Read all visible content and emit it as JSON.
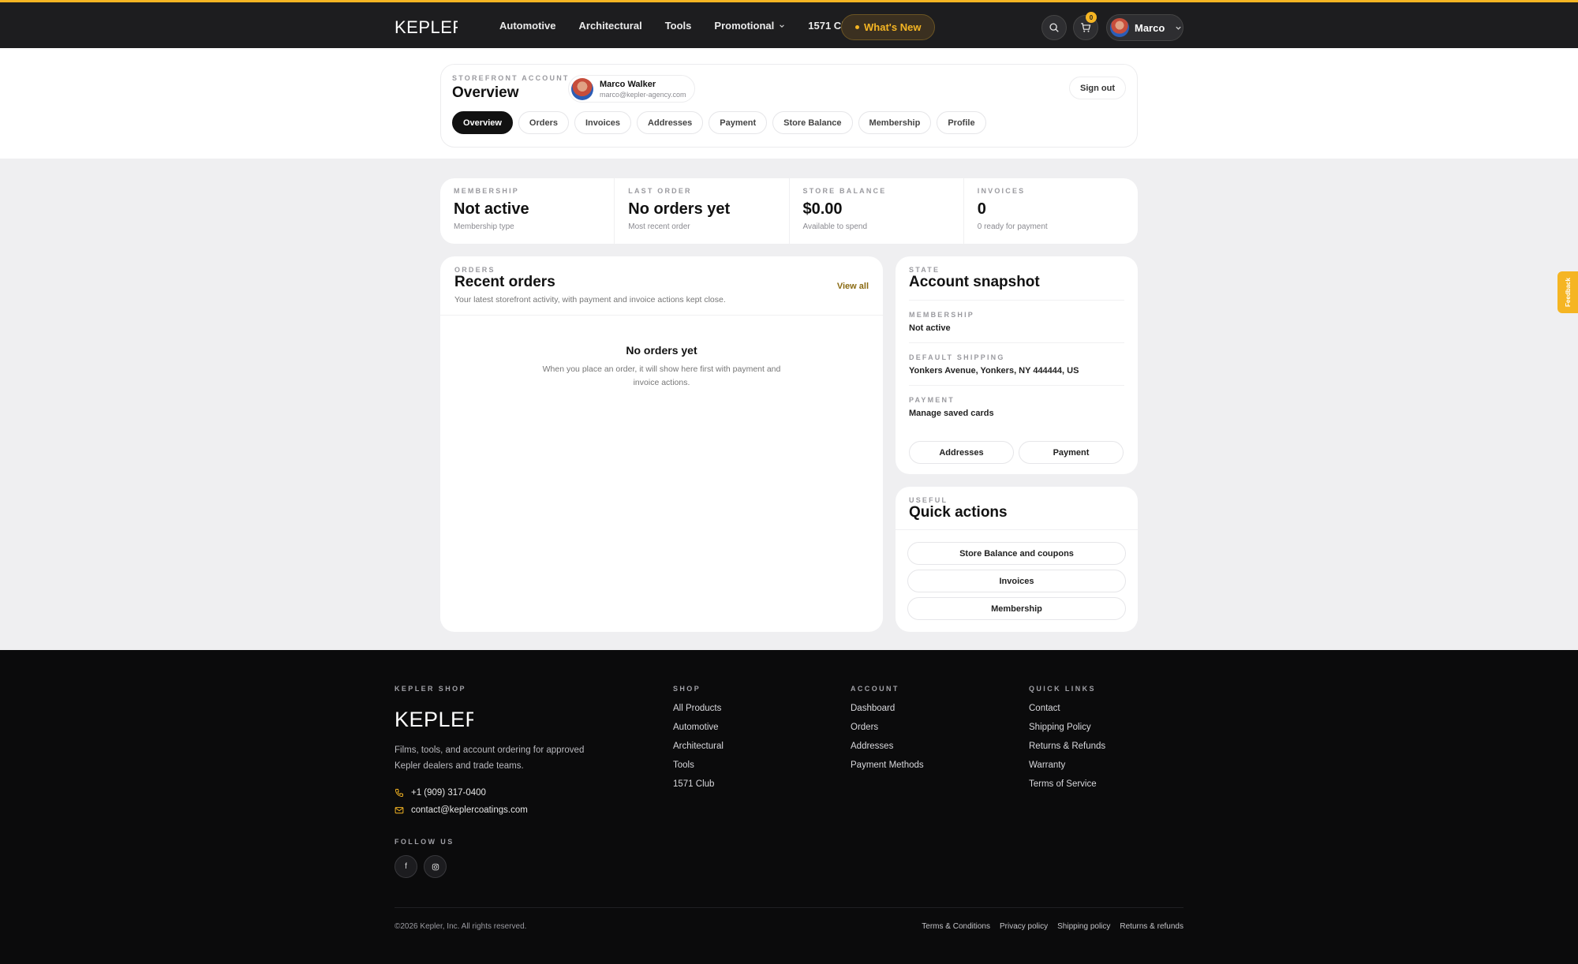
{
  "header": {
    "logo": "KEPLER",
    "nav": [
      {
        "label": "Automotive"
      },
      {
        "label": "Architectural"
      },
      {
        "label": "Tools"
      },
      {
        "label": "Promotional",
        "has_dropdown": true
      },
      {
        "label": "1571 Club"
      }
    ],
    "whats_new": "What's New",
    "cart_count": "0",
    "user_name": "Marco",
    "accent_color": "#f5b523"
  },
  "account": {
    "eyebrow": "STOREFRONT ACCOUNT",
    "title": "Overview",
    "profile_name": "Marco Walker",
    "profile_email": "marco@kepler-agency.com",
    "sign_out": "Sign out",
    "tabs": [
      {
        "label": "Overview",
        "active": true
      },
      {
        "label": "Orders"
      },
      {
        "label": "Invoices"
      },
      {
        "label": "Addresses"
      },
      {
        "label": "Payment"
      },
      {
        "label": "Store Balance"
      },
      {
        "label": "Membership"
      },
      {
        "label": "Profile"
      }
    ]
  },
  "stats": [
    {
      "eyebrow": "MEMBERSHIP",
      "value": "Not active",
      "sub": "Membership type"
    },
    {
      "eyebrow": "LAST ORDER",
      "value": "No orders yet",
      "sub": "Most recent order"
    },
    {
      "eyebrow": "STORE BALANCE",
      "value": "$0.00",
      "sub": "Available to spend"
    },
    {
      "eyebrow": "INVOICES",
      "value": "0",
      "sub": "0 ready for payment"
    }
  ],
  "orders": {
    "eyebrow": "ORDERS",
    "title": "Recent orders",
    "description": "Your latest storefront activity, with payment and invoice actions kept close.",
    "view_all": "View all",
    "empty_title": "No orders yet",
    "empty_description": "When you place an order, it will show here first with payment and invoice actions."
  },
  "snapshot": {
    "eyebrow": "STATE",
    "title": "Account snapshot",
    "rows": [
      {
        "label": "MEMBERSHIP",
        "value": "Not active"
      },
      {
        "label": "DEFAULT SHIPPING",
        "value": "Yonkers Avenue, Yonkers, NY 444444, US"
      },
      {
        "label": "PAYMENT",
        "value": "Manage saved cards"
      }
    ],
    "buttons": [
      "Addresses",
      "Payment"
    ]
  },
  "quick_actions": {
    "eyebrow": "USEFUL",
    "title": "Quick actions",
    "buttons": [
      "Store Balance and coupons",
      "Invoices",
      "Membership"
    ]
  },
  "feedback": "Feedback",
  "footer": {
    "brand_eyebrow": "KEPLER SHOP",
    "logo": "KEPLER",
    "description": "Films, tools, and account ordering for approved Kepler dealers and trade teams.",
    "phone": "+1 (909) 317-0400",
    "email": "contact@keplercoatings.com",
    "follow_us": "FOLLOW US",
    "social_facebook": "f",
    "columns": [
      {
        "title": "SHOP",
        "links": [
          "All Products",
          "Automotive",
          "Architectural",
          "Tools",
          "1571 Club"
        ]
      },
      {
        "title": "ACCOUNT",
        "links": [
          "Dashboard",
          "Orders",
          "Addresses",
          "Payment Methods"
        ]
      },
      {
        "title": "QUICK LINKS",
        "links": [
          "Contact",
          "Shipping Policy",
          "Returns & Refunds",
          "Warranty",
          "Terms of Service"
        ]
      }
    ],
    "copyright": "©2026 Kepler, Inc. All rights reserved.",
    "legal_links": [
      "Terms & Conditions",
      "Privacy policy",
      "Shipping policy",
      "Returns & refunds"
    ]
  }
}
